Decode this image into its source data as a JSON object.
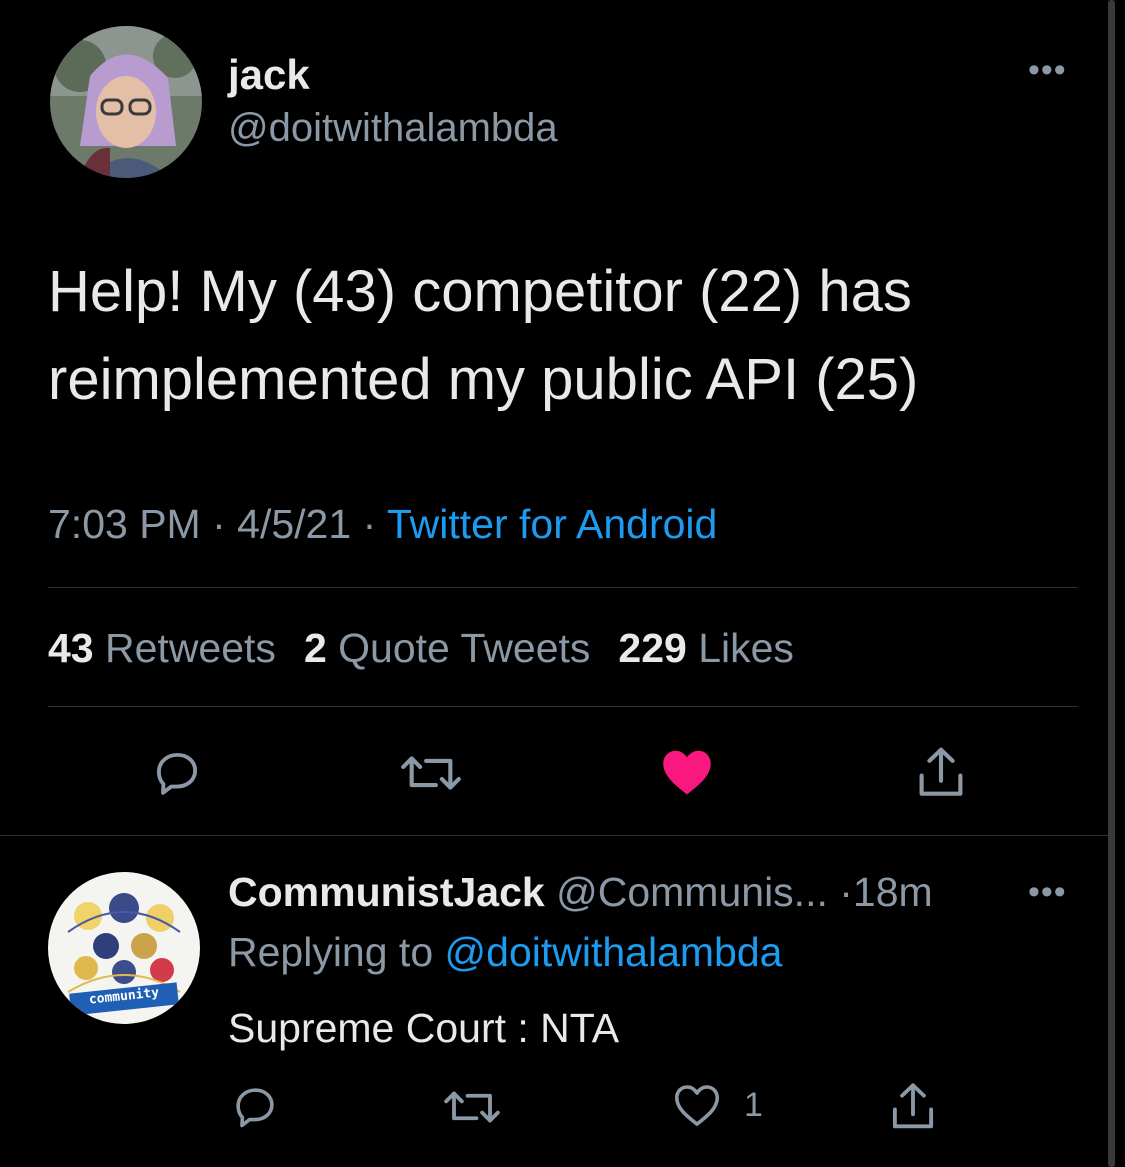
{
  "tweet": {
    "author": {
      "name": "jack",
      "handle": "@doitwithalambda"
    },
    "text": "Help! My (43) competitor (22) has reimplemented my public API (25)",
    "time": "7:03 PM",
    "date": "4/5/21",
    "separator": "·",
    "source": "Twitter for Android",
    "stats": {
      "retweets_count": "43",
      "retweets_label": "Retweets",
      "quotes_count": "2",
      "quotes_label": "Quote Tweets",
      "likes_count": "229",
      "likes_label": "Likes"
    },
    "liked": true,
    "more_icon": "more-horizontal-icon",
    "actions": [
      "reply-icon",
      "retweet-icon",
      "heart-filled-icon",
      "share-icon"
    ]
  },
  "reply": {
    "name": "CommunistJack",
    "handle": "@Communis...",
    "separator": "·",
    "age": "18m",
    "replying_prefix": "Replying to",
    "replying_to": "@doitwithalambda",
    "text": "Supreme Court : NTA",
    "like_count": "1",
    "avatar_logo_text": "community",
    "actions": [
      "reply-icon",
      "retweet-icon",
      "heart-outline-icon",
      "share-icon"
    ]
  },
  "colors": {
    "background": "#000000",
    "text": "#e7e9ea",
    "secondary": "#8b98a5",
    "link": "#1d9bf0",
    "like": "#f91880",
    "divider": "#2f3336"
  }
}
